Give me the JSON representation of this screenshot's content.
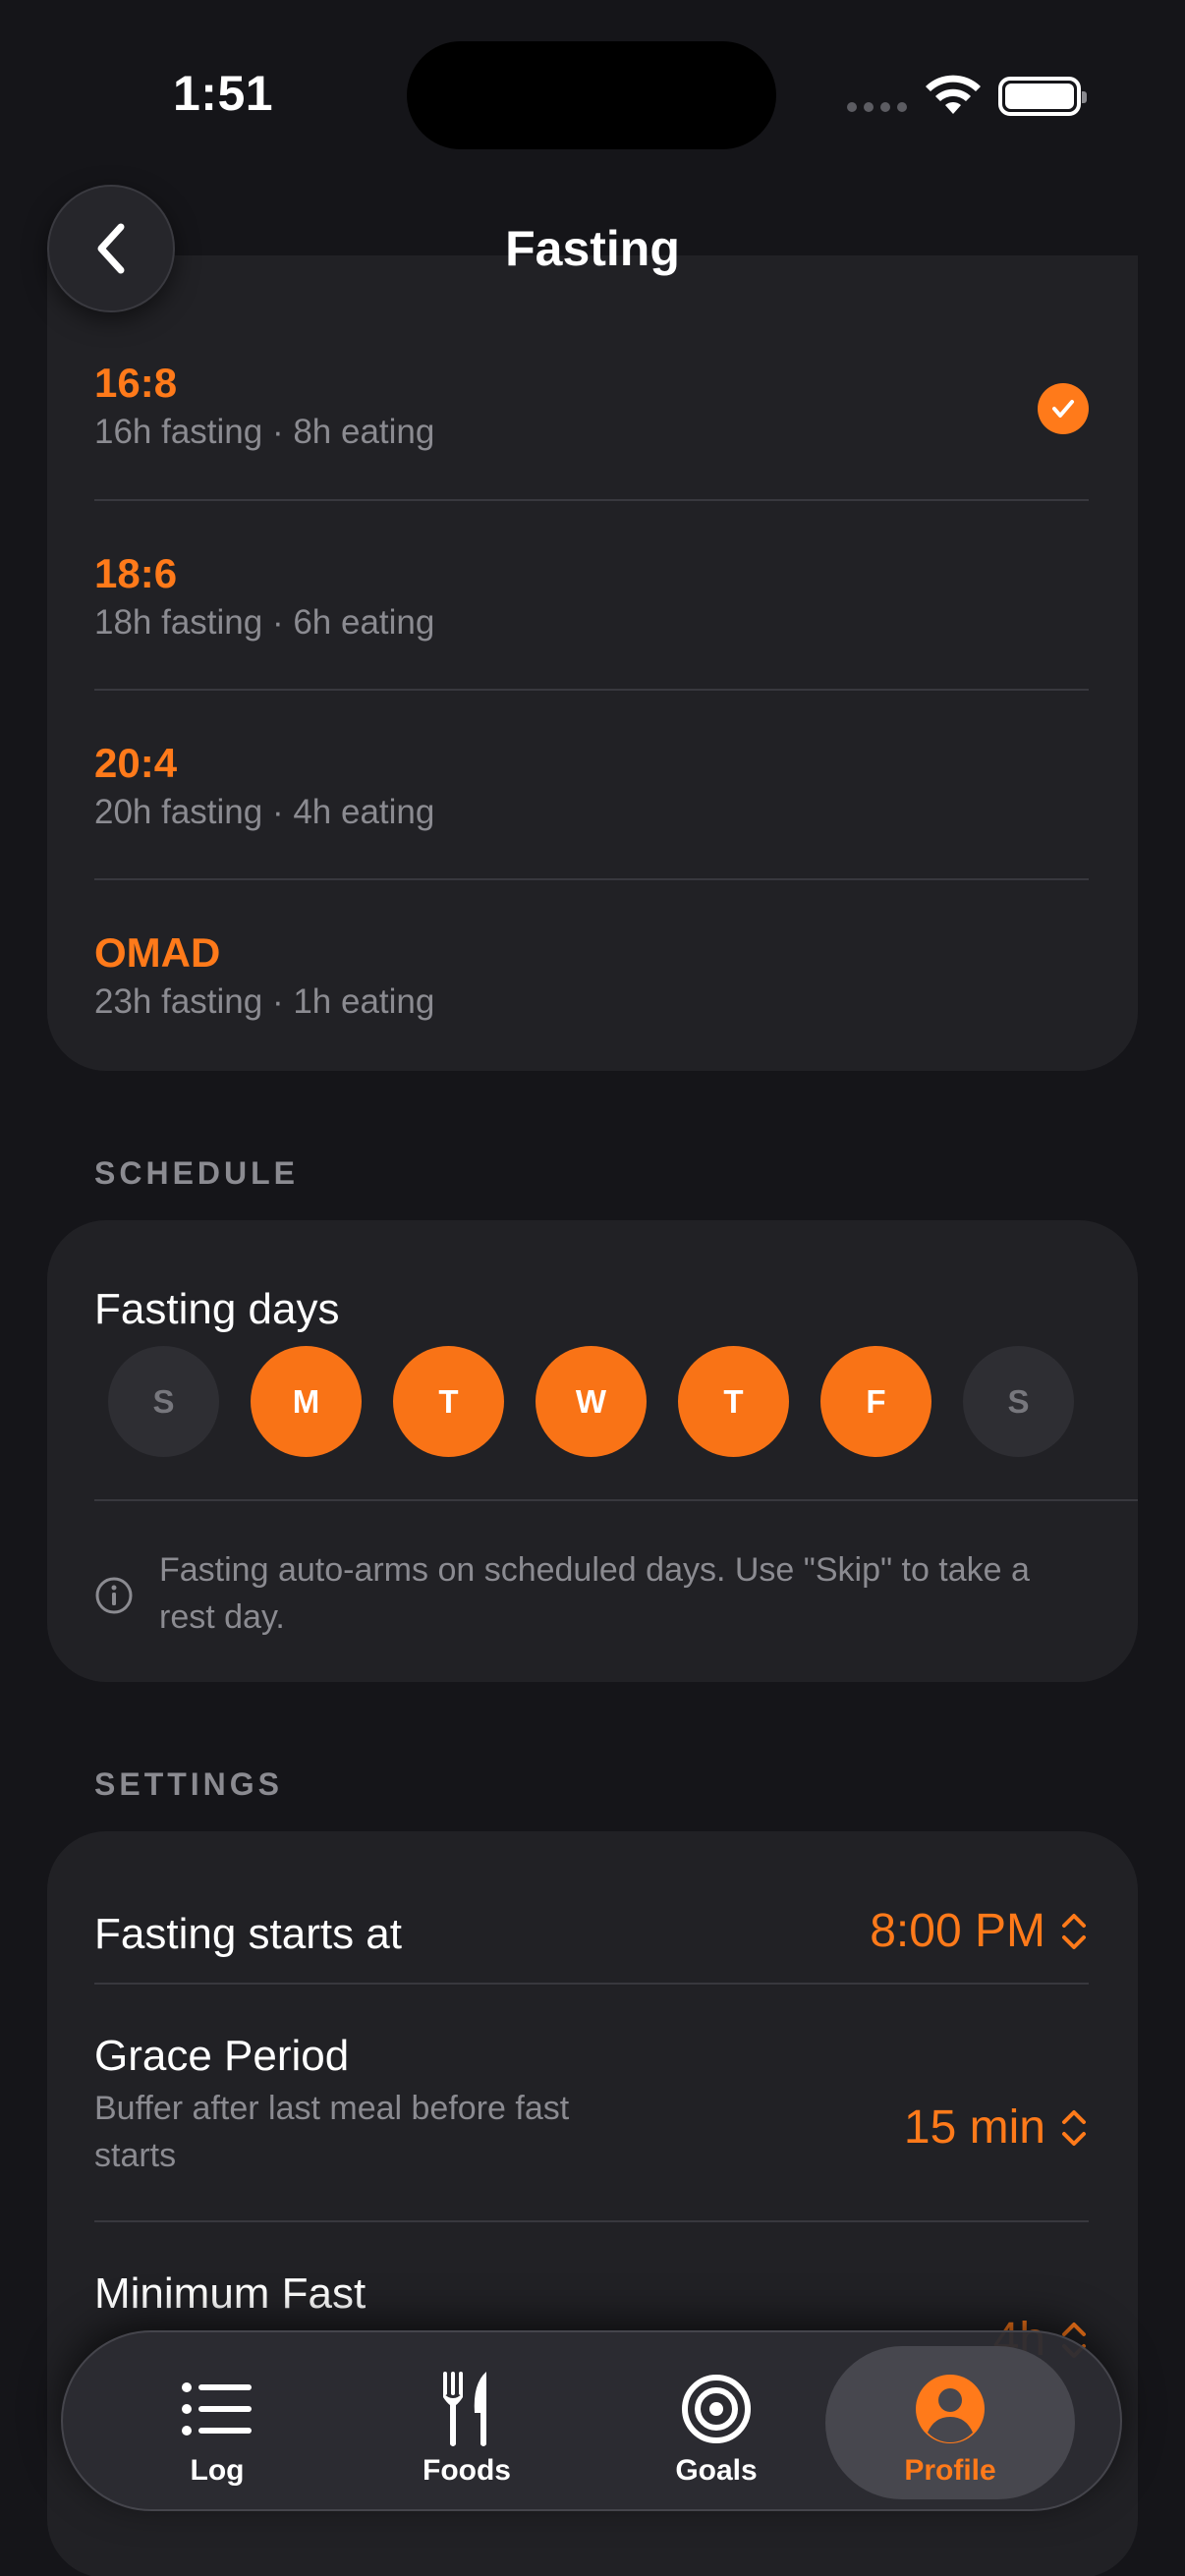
{
  "status_bar": {
    "time": "1:51"
  },
  "header": {
    "title": "Fasting"
  },
  "plans": [
    {
      "name": "16:8",
      "description": "16h fasting · 8h eating",
      "selected": true
    },
    {
      "name": "18:6",
      "description": "18h fasting · 6h eating",
      "selected": false
    },
    {
      "name": "20:4",
      "description": "20h fasting · 4h eating",
      "selected": false
    },
    {
      "name": "OMAD",
      "description": "23h fasting · 1h eating",
      "selected": false
    }
  ],
  "schedule": {
    "section_label": "SCHEDULE",
    "title": "Fasting days",
    "days": [
      {
        "label": "S",
        "active": false
      },
      {
        "label": "M",
        "active": true
      },
      {
        "label": "T",
        "active": true
      },
      {
        "label": "W",
        "active": true
      },
      {
        "label": "T",
        "active": true
      },
      {
        "label": "F",
        "active": true
      },
      {
        "label": "S",
        "active": false
      }
    ],
    "info": "Fasting auto-arms on scheduled days. Use \"Skip\" to take a rest day."
  },
  "settings": {
    "section_label": "SETTINGS",
    "start": {
      "title": "Fasting starts at",
      "value": "8:00 PM"
    },
    "grace": {
      "title": "Grace Period",
      "subtitle": "Buffer after last meal before fast starts",
      "value": "15 min"
    },
    "minimum": {
      "title": "Minimum Fast",
      "value": "4h"
    }
  },
  "tabbar": {
    "items": [
      {
        "label": "Log",
        "icon": "list-icon",
        "active": false
      },
      {
        "label": "Foods",
        "icon": "fork-knife-icon",
        "active": false
      },
      {
        "label": "Goals",
        "icon": "target-icon",
        "active": false
      },
      {
        "label": "Profile",
        "icon": "person-circle-icon",
        "active": true
      }
    ]
  },
  "colors": {
    "accent": "#ff7a1a",
    "background": "#151519",
    "card": "#212125"
  }
}
